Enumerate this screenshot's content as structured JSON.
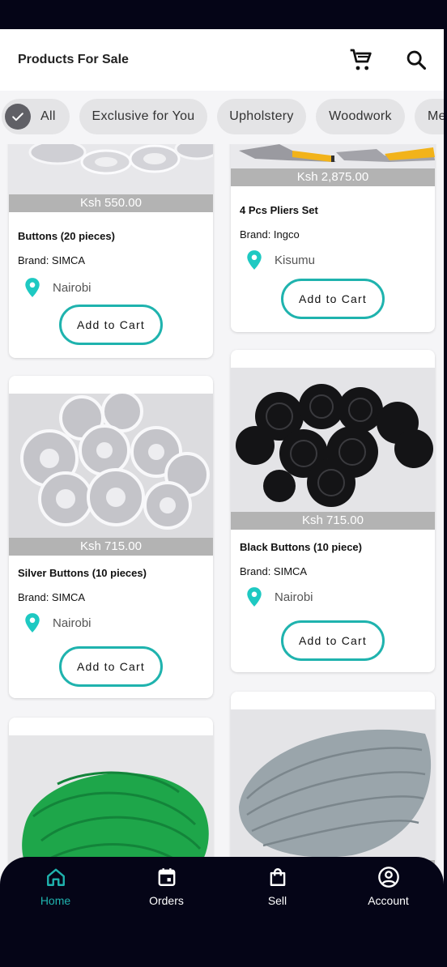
{
  "header": {
    "title": "Products For Sale"
  },
  "icons": {
    "cart": "shopping-cart-icon",
    "search": "search-icon"
  },
  "categories": [
    {
      "label": "All",
      "selected": true
    },
    {
      "label": "Exclusive for You",
      "selected": false
    },
    {
      "label": "Upholstery",
      "selected": false
    },
    {
      "label": "Woodwork",
      "selected": false
    },
    {
      "label": "Me",
      "selected": false
    }
  ],
  "products": [
    {
      "name": "Buttons (20 pieces)",
      "price": "Ksh 550.00",
      "brand": "Brand: SIMCA",
      "location": "Nairobi",
      "button": "Add to Cart"
    },
    {
      "name": "4 Pcs Pliers Set",
      "price": "Ksh 2,875.00",
      "brand": "Brand: Ingco",
      "location": "Kisumu",
      "button": "Add to Cart"
    },
    {
      "name": "Silver Buttons (10 pieces)",
      "price": "Ksh 715.00",
      "brand": "Brand: SIMCA",
      "location": "Nairobi",
      "button": "Add to Cart"
    },
    {
      "name": "Black Buttons (10 piece)",
      "price": "Ksh 715.00",
      "brand": "Brand: SIMCA",
      "location": "Nairobi",
      "button": "Add to Cart"
    }
  ],
  "bottom_nav": [
    {
      "label": "Home",
      "icon": "home-icon",
      "active": true
    },
    {
      "label": "Orders",
      "icon": "calendar-icon",
      "active": false
    },
    {
      "label": "Sell",
      "icon": "shopping-bag-icon",
      "active": false
    },
    {
      "label": "Account",
      "icon": "account-circle-icon",
      "active": false
    }
  ],
  "colors": {
    "accent": "#1fb3ae",
    "nav_bg": "#050517",
    "price_bar": "#b3b3b3",
    "chip_bg": "#e4e4e6"
  }
}
